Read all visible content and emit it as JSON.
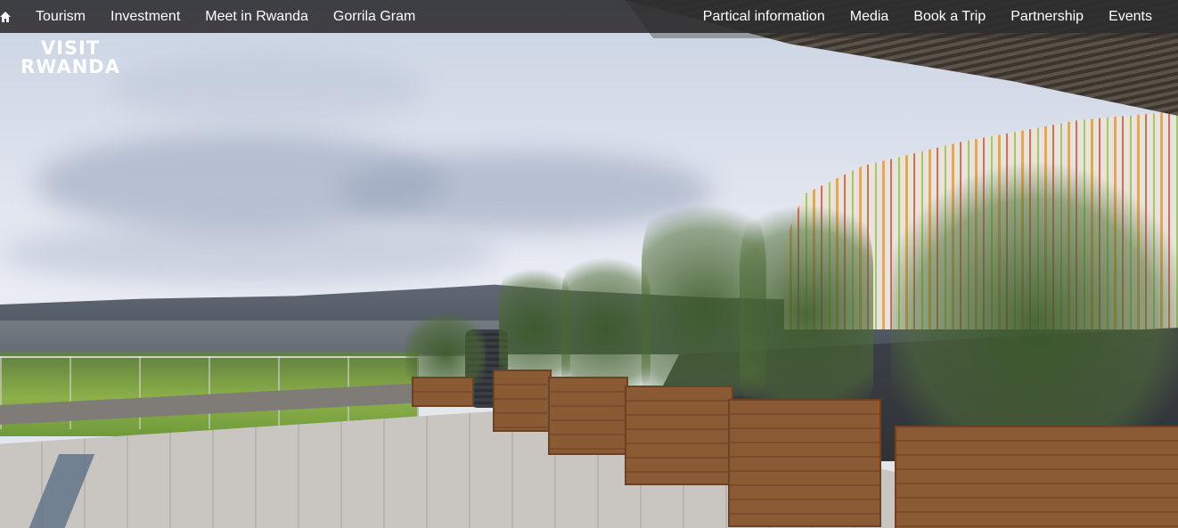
{
  "nav": {
    "home_icon": "home-icon",
    "left": [
      {
        "label": "Tourism"
      },
      {
        "label": "Investment"
      },
      {
        "label": "Meet in Rwanda"
      },
      {
        "label": "Gorrila Gram"
      }
    ],
    "right": [
      {
        "label": "Partical information"
      },
      {
        "label": "Media"
      },
      {
        "label": "Book a Trip"
      },
      {
        "label": "Partnership"
      },
      {
        "label": "Events"
      }
    ]
  },
  "logo": {
    "line1": "VISIT",
    "line2": "RWANDA"
  },
  "hero": {
    "image": "rooftop terrace with planters overlooking hills and a striped stadium facade"
  }
}
